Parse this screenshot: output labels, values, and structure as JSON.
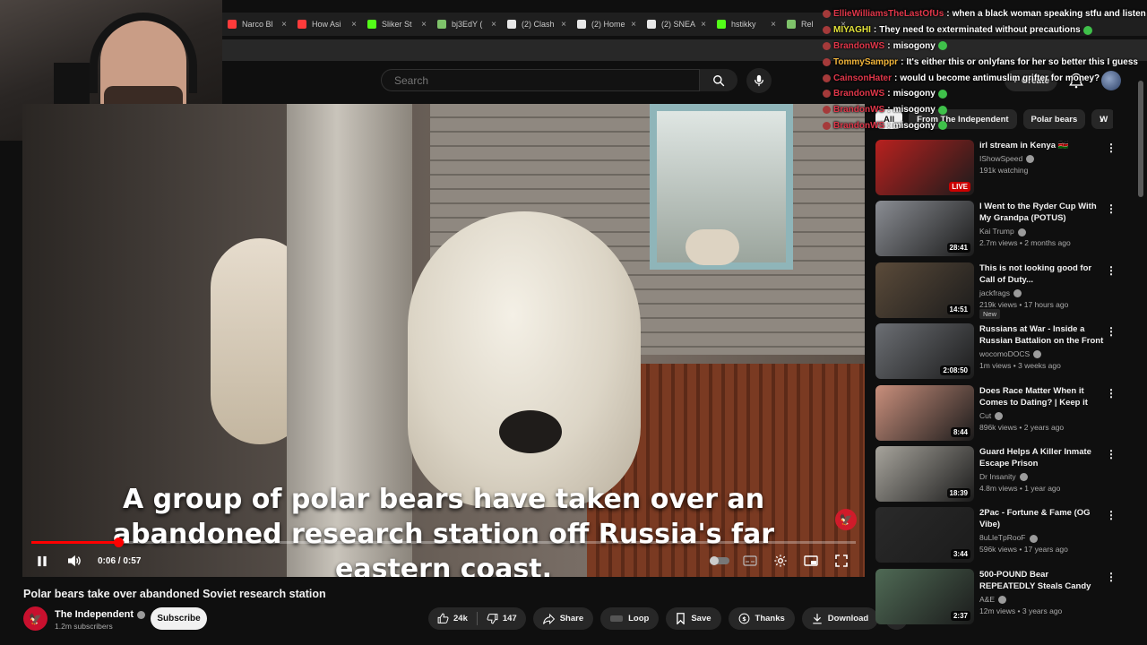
{
  "browser": {
    "tabs": [
      {
        "label": "Narco Bl",
        "color": "#ff3b3b"
      },
      {
        "label": "How Asi",
        "color": "#ff3b3b"
      },
      {
        "label": "Sliker St",
        "color": "#53fc18"
      },
      {
        "label": "bj3EdY (",
        "color": "#7ec26a"
      },
      {
        "label": "(2) Clash",
        "color": "#e7e7e7"
      },
      {
        "label": "(2) Home",
        "color": "#e7e7e7"
      },
      {
        "label": "(2) SNEA",
        "color": "#e7e7e7"
      },
      {
        "label": "hstikky",
        "color": "#53fc18"
      },
      {
        "label": "Rel",
        "color": "#7ec26a"
      }
    ]
  },
  "header": {
    "search_placeholder": "Search",
    "create_label": "Create"
  },
  "chat": [
    {
      "user": "EllieWilliamsTheLastOfUs",
      "user_color": "#e0374a",
      "message": "when a black woman speaking stfu and listen",
      "emote": false
    },
    {
      "user": "MIYAGHI",
      "user_color": "#e2e23a",
      "message": "They need to exterminated without precautions",
      "emote": true
    },
    {
      "user": "BrandonWS",
      "user_color": "#e0374a",
      "message": "misogony",
      "emote": true
    },
    {
      "user": "TommySamppr",
      "user_color": "#f0b43a",
      "message": "It's either this or onlyfans for her so better this I guess",
      "emote": false
    },
    {
      "user": "CainsonHater",
      "user_color": "#e0374a",
      "message": "would u become antimuslim grifter for money?",
      "emote": false
    },
    {
      "user": "BrandonWS",
      "user_color": "#e0374a",
      "message": "misogony",
      "emote": true
    },
    {
      "user": "BrandonWS",
      "user_color": "#e0374a",
      "message": "misogony",
      "emote": true
    },
    {
      "user": "BrandonWS",
      "user_color": "#e0374a",
      "message": "misogony",
      "emote": true
    }
  ],
  "video": {
    "caption": "A group of polar bears have taken over an abandoned research station off Russia's far eastern coast.",
    "current_time": "0:06",
    "duration": "0:57",
    "progress": 0.105,
    "title": "Polar bears take over abandoned Soviet research station"
  },
  "channel": {
    "name": "The Independent",
    "subscribers": "1.2m subscribers",
    "subscribe_label": "Subscribe"
  },
  "actions": {
    "likes": "24k",
    "dislikes": "147",
    "share": "Share",
    "loop": "Loop",
    "save": "Save",
    "thanks": "Thanks",
    "download": "Download"
  },
  "chips": [
    {
      "label": "All",
      "active": true
    },
    {
      "label": "From The Independent",
      "active": false
    },
    {
      "label": "Polar bears",
      "active": false
    },
    {
      "label": "W",
      "active": false
    }
  ],
  "recommendations": [
    {
      "title": "irl stream in Kenya 🇰🇪",
      "channel": "IShowSpeed",
      "meta": "191k watching",
      "duration": "LIVE",
      "live": true,
      "new": false,
      "thumb": "#b8211f"
    },
    {
      "title": "I Went to the Ryder Cup With My Grandpa (POTUS)",
      "channel": "Kai Trump",
      "meta": "2.7m views • 2 months ago",
      "duration": "28:41",
      "live": false,
      "new": false,
      "thumb": "#8a8d93"
    },
    {
      "title": "This is not looking good for Call of Duty...",
      "channel": "jackfrags",
      "meta": "219k views • 17 hours ago",
      "duration": "14:51",
      "live": false,
      "new": true,
      "thumb": "#5b4b3a"
    },
    {
      "title": "Russians at War - Inside a Russian Battalion on the Front ...",
      "channel": "wocomoDOCS",
      "meta": "1m views • 3 weeks ago",
      "duration": "2:08:50",
      "live": false,
      "new": false,
      "thumb": "#6c6f74"
    },
    {
      "title": "Does Race Matter When it Comes to Dating? | Keep it 100...",
      "channel": "Cut",
      "meta": "896k views • 2 years ago",
      "duration": "8:44",
      "live": false,
      "new": false,
      "thumb": "#c98f7c"
    },
    {
      "title": "Guard Helps A Killer Inmate Escape Prison",
      "channel": "Dr Insanity",
      "meta": "4.8m views • 1 year ago",
      "duration": "18:39",
      "live": false,
      "new": false,
      "thumb": "#a7a49c"
    },
    {
      "title": "2Pac - Fortune & Fame (OG Vibe)",
      "channel": "8uLleTpRooF",
      "meta": "596k views • 17 years ago",
      "duration": "3:44",
      "live": false,
      "new": false,
      "thumb": "#2a2a2a"
    },
    {
      "title": "500-POUND Bear REPEATEDLY Steals Candy from Gas Station...",
      "channel": "A&E",
      "meta": "12m views • 3 years ago",
      "duration": "2:37",
      "live": false,
      "new": false,
      "thumb": "#4f6a55"
    }
  ]
}
